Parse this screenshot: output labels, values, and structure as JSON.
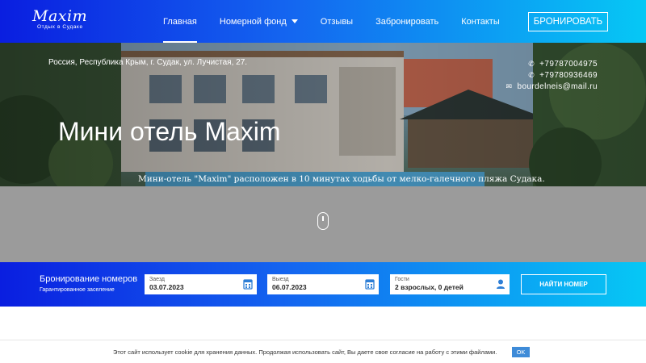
{
  "logo": {
    "main": "Maxim",
    "sub": "Отдых в Судаке"
  },
  "nav": {
    "items": [
      {
        "label": "Главная",
        "active": true
      },
      {
        "label": "Номерной фонд",
        "dropdown": true
      },
      {
        "label": "Отзывы"
      },
      {
        "label": "Забронировать"
      },
      {
        "label": "Контакты"
      }
    ],
    "book_button": "БРОНИРОВАТЬ"
  },
  "hero": {
    "address": "Россия, Республика Крым, г. Судак, ул. Лучистая, 27.",
    "phone1": "+79787004975",
    "phone2": "+79780936469",
    "email": "bourdelneis@mail.ru",
    "title": "Мини отель Maxim",
    "subtitle": "Мини-отель \"Maxim\" расположен в 10 минутах ходьбы от мелко-галечного пляжа Судака."
  },
  "booking": {
    "title": "Бронирование номеров",
    "subtitle": "Гарантированное заселение",
    "checkin_label": "Заезд",
    "checkin_value": "03.07.2023",
    "checkout_label": "Выезд",
    "checkout_value": "06.07.2023",
    "guests_label": "Гости",
    "guests_value": "2 взрослых, 0 детей",
    "search_button": "НАЙТИ НОМЕР"
  },
  "cookie": {
    "text": "Этот сайт использует cookie для хранения данных. Продолжая использовать сайт, Вы даете свое согласие на работу с этими файлами.",
    "ok": "OK"
  },
  "colors": {
    "accent_start": "#0a1ee0",
    "accent_end": "#06c8f5",
    "ok_button": "#3e8bd8",
    "grey_area": "#9b9b9b"
  },
  "icons": [
    "phone-icon",
    "envelope-icon",
    "calendar-icon",
    "user-icon",
    "chevron-down-icon",
    "scroll-mouse-icon"
  ]
}
